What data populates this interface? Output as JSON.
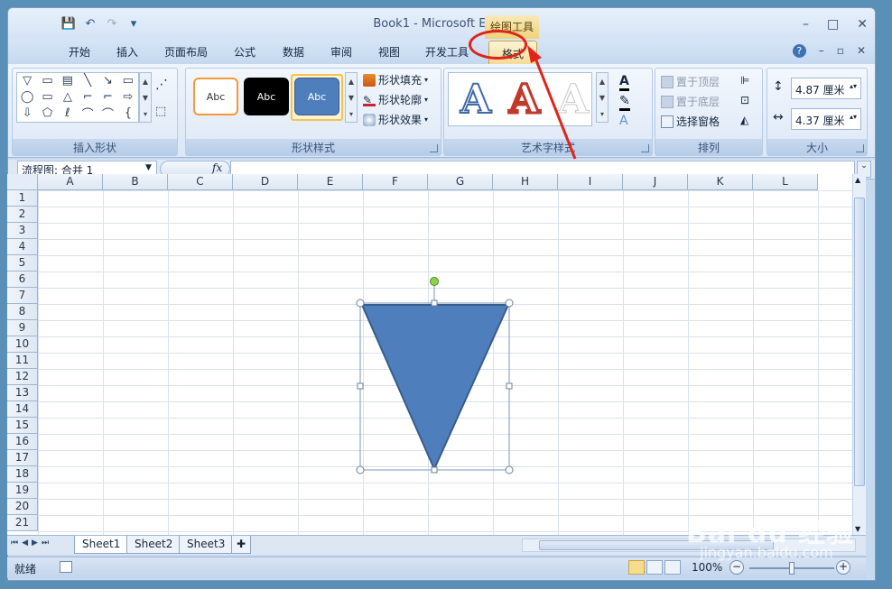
{
  "window": {
    "title": "Book1 - Microsoft Excel",
    "context_group": "绘图工具"
  },
  "qat": {
    "save": "💾",
    "undo": "↶",
    "redo": "↷",
    "customize": "▾"
  },
  "window_controls": {
    "minimize": "–",
    "maximize": "□",
    "close": "✕"
  },
  "tabs": [
    "开始",
    "插入",
    "页面布局",
    "公式",
    "数据",
    "审阅",
    "视图",
    "开发工具"
  ],
  "active_tab": "格式",
  "tab_right": {
    "help": "?",
    "min": "–",
    "restore": "▫",
    "close": "✕"
  },
  "ribbon": {
    "insert_shapes": {
      "label": "插入形状",
      "shapes": [
        "▽",
        "▭",
        "▤",
        "╲",
        "↘",
        "▭",
        "◯",
        "▭",
        "△",
        "⌐",
        "⌐",
        "⇨",
        "⇩",
        "⬠",
        "ℓ",
        "⌒",
        "⌒",
        "{"
      ],
      "edit_icon": "⬚"
    },
    "shape_styles": {
      "label": "形状样式",
      "thumbs": [
        "Abc",
        "Abc",
        "Abc"
      ],
      "fill": "形状填充",
      "outline": "形状轮廓",
      "effects": "形状效果"
    },
    "wordart_styles": {
      "label": "艺术字样式",
      "letters": [
        "A",
        "A",
        "A"
      ]
    },
    "arrange": {
      "label": "排列",
      "bring_front": "置于顶层",
      "send_back": "置于底层",
      "selection_pane": "选择窗格"
    },
    "size": {
      "label": "大小",
      "height": "4.87 厘米",
      "width": "4.37 厘米"
    }
  },
  "formula_bar": {
    "name_box": "流程图: 合并  1",
    "fx": "fx",
    "value": ""
  },
  "columns": [
    "A",
    "B",
    "C",
    "D",
    "E",
    "F",
    "G",
    "H",
    "I",
    "J",
    "K",
    "L"
  ],
  "rows": [
    "1",
    "2",
    "3",
    "4",
    "5",
    "6",
    "7",
    "8",
    "9",
    "10",
    "11",
    "12",
    "13",
    "14",
    "15",
    "16",
    "17",
    "18",
    "19",
    "20",
    "21"
  ],
  "shape": {
    "type": "流程图: 合并",
    "fill": "#4f7ebc",
    "outline": "#385d8a"
  },
  "sheets": [
    "Sheet1",
    "Sheet2",
    "Sheet3"
  ],
  "status": {
    "ready": "就绪",
    "zoom": "100%"
  },
  "watermark": {
    "main": "Bai du 经验",
    "sub": "jingyan.baidu.com"
  },
  "colors": {
    "accent": "#e1231a",
    "ribbon_bg": "#dbe7f6",
    "tab_active": "#f4dc95"
  }
}
